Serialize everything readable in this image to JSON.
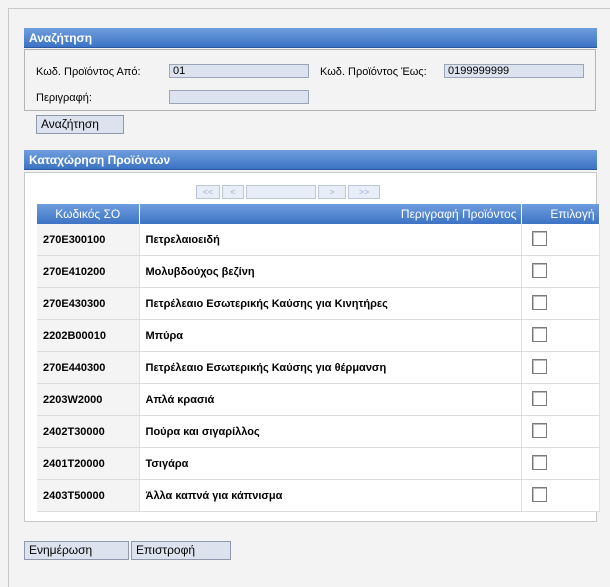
{
  "search": {
    "header": "Αναζήτηση",
    "code_from_label": "Κωδ. Προϊόντος Από:",
    "code_from_value": "01",
    "code_to_label": "Κωδ. Προϊόντος Έως:",
    "code_to_value": "0199999999",
    "description_label": "Περιγραφή:",
    "description_value": "",
    "search_button": "Αναζήτηση"
  },
  "registration": {
    "header": "Καταχώρηση Προϊόντων",
    "pager": {
      "first": "<<",
      "prev": "<",
      "next": ">",
      "last": ">>"
    },
    "columns": [
      "Κωδικός ΣΟ",
      "Περιγραφή Προϊόντος",
      "Επιλογή"
    ],
    "rows": [
      {
        "code": "270E300100",
        "description": "Πετρελαιοειδή",
        "checked": false
      },
      {
        "code": "270E410200",
        "description": "Μολυβδούχος βεζίνη",
        "checked": false
      },
      {
        "code": "270E430300",
        "description": "Πετρέλεαιο Εσωτερικής Καύσης για Κινητήρες",
        "checked": false
      },
      {
        "code": "2202B00010",
        "description": "Μπύρα",
        "checked": false
      },
      {
        "code": "270E440300",
        "description": "Πετρέλεαιο Εσωτερικής Καύσης για θέρμανση",
        "checked": false
      },
      {
        "code": "2203W2000",
        "description": "Απλά κρασιά",
        "checked": false
      },
      {
        "code": "2402T30000",
        "description": "Πούρα και σιγαρίλλος",
        "checked": false
      },
      {
        "code": "2401T20000",
        "description": "Τσιγάρα",
        "checked": false
      },
      {
        "code": "2403T50000",
        "description": "Άλλα καπνά για κάπνισμα",
        "checked": false
      }
    ]
  },
  "footer": {
    "update_button": "Ενημέρωση",
    "return_button": "Επιστροφή"
  }
}
